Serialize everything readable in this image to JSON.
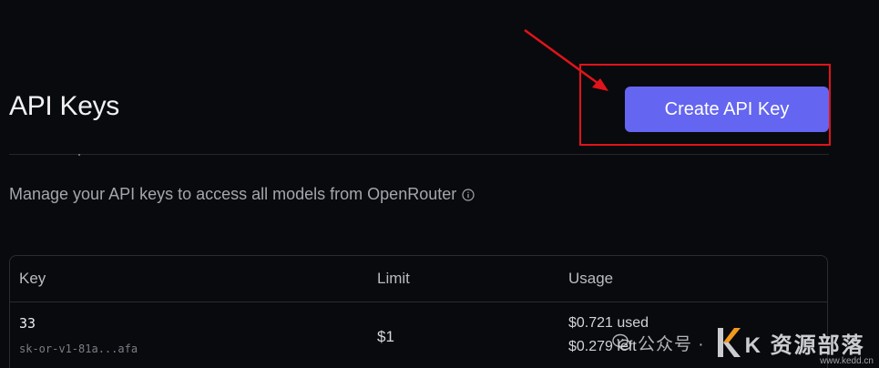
{
  "header": {
    "title": "API Keys",
    "create_button_label": "Create API Key"
  },
  "subtitle": "Manage your API keys to access all models from OpenRouter",
  "table": {
    "columns": [
      "Key",
      "Limit",
      "Usage"
    ],
    "rows": [
      {
        "name": "33",
        "key": "sk-or-v1-81a...afa",
        "limit": "$1",
        "usage_used": "$0.721 used",
        "usage_left": "$0.279 left"
      }
    ]
  },
  "watermark": {
    "channel_label": "公众号 · ",
    "brand": "K 资源部落",
    "url": "www.kedd.cn"
  },
  "colors": {
    "background": "#090a0d",
    "primary_button": "#6465f0",
    "annotation_red": "#e0141a"
  },
  "icons": {
    "info": "info-circle-icon",
    "annotation_arrow": "arrow-icon",
    "wechat": "wechat-icon",
    "brand_logo": "k-logo-icon"
  }
}
